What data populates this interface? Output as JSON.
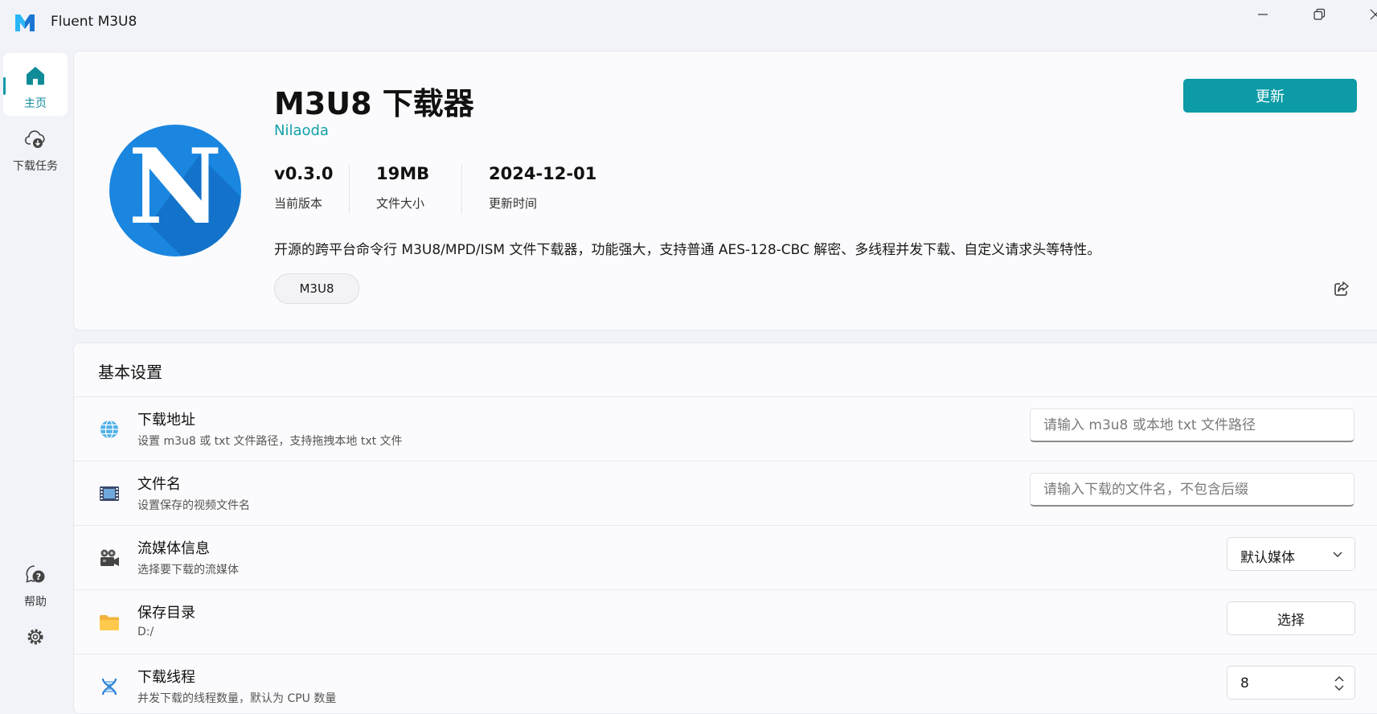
{
  "window": {
    "title": "Fluent M3U8"
  },
  "nav": {
    "home": "主页",
    "tasks": "下载任务",
    "help": "帮助"
  },
  "hero": {
    "name": "M3U8 下载器",
    "author": "Nilaoda",
    "update_label": "更新",
    "stats": [
      {
        "value": "v0.3.0",
        "label": "当前版本"
      },
      {
        "value": "19MB",
        "label": "文件大小"
      },
      {
        "value": "2024-12-01",
        "label": "更新时间"
      }
    ],
    "description": "开源的跨平台命令行 M3U8/MPD/ISM 文件下载器，功能强大，支持普通 AES-128-CBC 解密、多线程并发下载、自定义请求头等特性。",
    "tag": "M3U8",
    "logo_letter": "N"
  },
  "settings": {
    "title": "基本设置",
    "url": {
      "title": "下载地址",
      "subtitle": "设置 m3u8 或 txt 文件路径，支持拖拽本地 txt 文件",
      "placeholder": "请输入 m3u8 或本地 txt 文件路径"
    },
    "filename": {
      "title": "文件名",
      "subtitle": "设置保存的视频文件名",
      "placeholder": "请输入下载的文件名，不包含后缀"
    },
    "media": {
      "title": "流媒体信息",
      "subtitle": "选择要下载的流媒体",
      "selected": "默认媒体"
    },
    "save_dir": {
      "title": "保存目录",
      "subtitle": "D:/",
      "button": "选择"
    },
    "threads": {
      "title": "下载线程",
      "subtitle": "并发下载的线程数量，默认为 CPU 数量",
      "value": "8"
    }
  },
  "colors": {
    "accent": "#0c9ba7",
    "logo_blue": "#1a86e0",
    "background": "#f1f3f8"
  }
}
